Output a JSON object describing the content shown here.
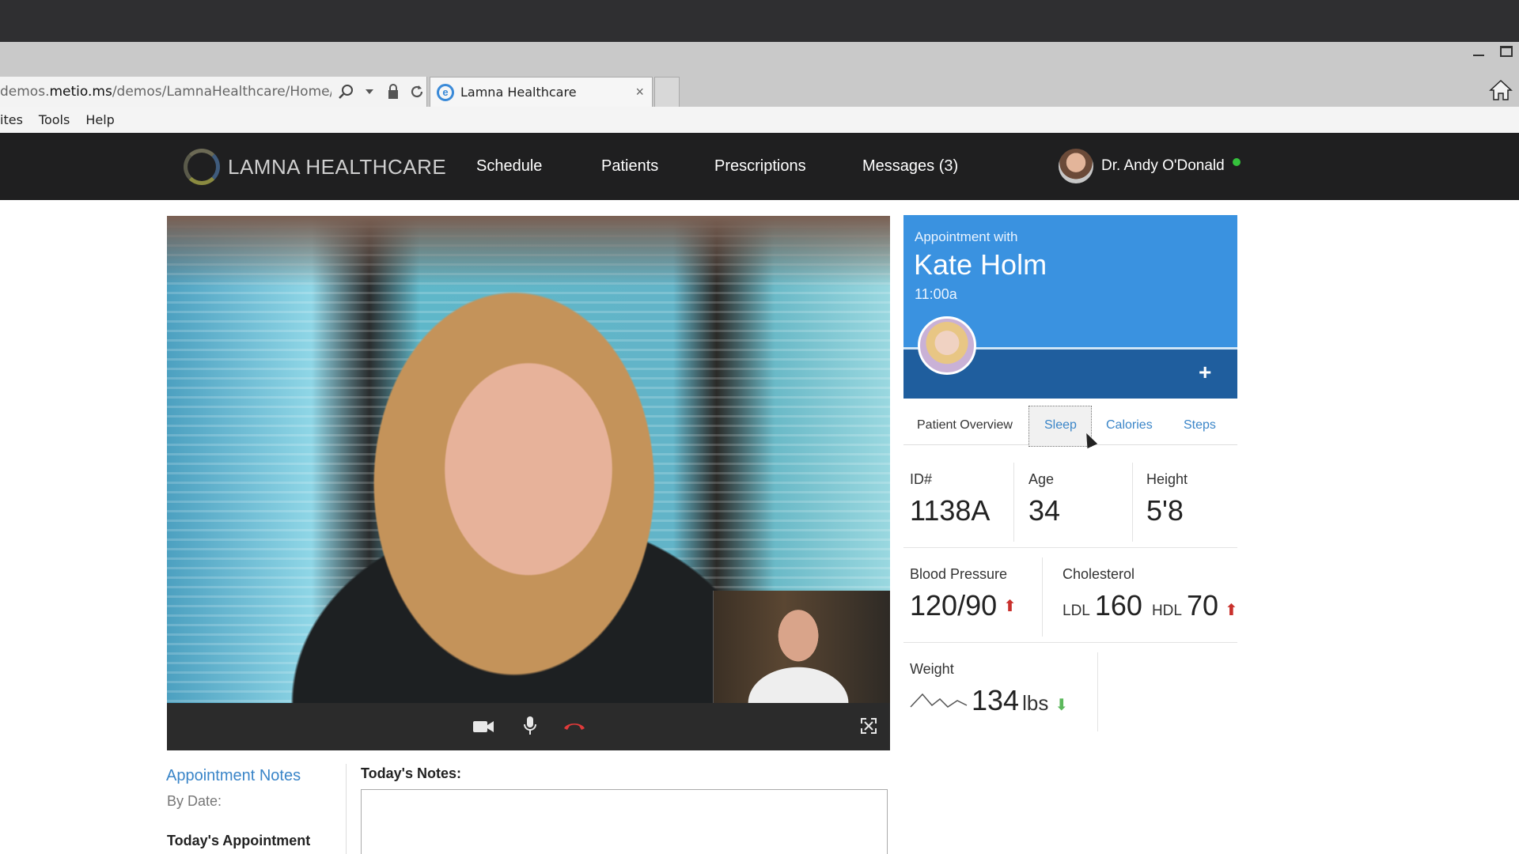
{
  "browser": {
    "address_prefix": "demos.",
    "address_host": "metio.ms",
    "address_path": "/demos/LamnaHealthcare/Home/Appo",
    "tab_title": "Lamna Healthcare",
    "tab_close": "×",
    "menu": [
      "ites",
      "Tools",
      "Help"
    ]
  },
  "app": {
    "logo": "LAMNA HEALTHCARE",
    "nav": [
      "Schedule",
      "Patients",
      "Prescriptions",
      "Messages (3)"
    ],
    "doctor_name": "Dr. Andy O'Donald",
    "status_color": "#35c23c"
  },
  "appointment": {
    "label": "Appointment with",
    "patient_name": "Kate Holm",
    "time": "11:00a",
    "add_symbol": "+"
  },
  "tabs": [
    "Patient Overview",
    "Sleep",
    "Calories",
    "Steps"
  ],
  "stats": {
    "id_label": "ID#",
    "id_value": "1138A",
    "age_label": "Age",
    "age_value": "34",
    "height_label": "Height",
    "height_value": "5'8",
    "bp_label": "Blood Pressure",
    "bp_value": "120/90",
    "chol_label": "Cholesterol",
    "ldl_label": "LDL",
    "ldl_value": "160",
    "hdl_label": "HDL",
    "hdl_value": "70",
    "weight_label": "Weight",
    "weight_value": "134",
    "weight_unit": "lbs"
  },
  "notes": {
    "title": "Appointment Notes",
    "by_date": "By Date:",
    "todays_appointment": "Today's Appointment",
    "todays_notes": "Today's Notes:"
  },
  "colors": {
    "accent": "#3a92e0",
    "accent_dark": "#1f5e9e",
    "nav_bg": "#1f1f20",
    "link": "#3a85c8",
    "trend_up": "#c9302c",
    "trend_down": "#5cb85c"
  }
}
